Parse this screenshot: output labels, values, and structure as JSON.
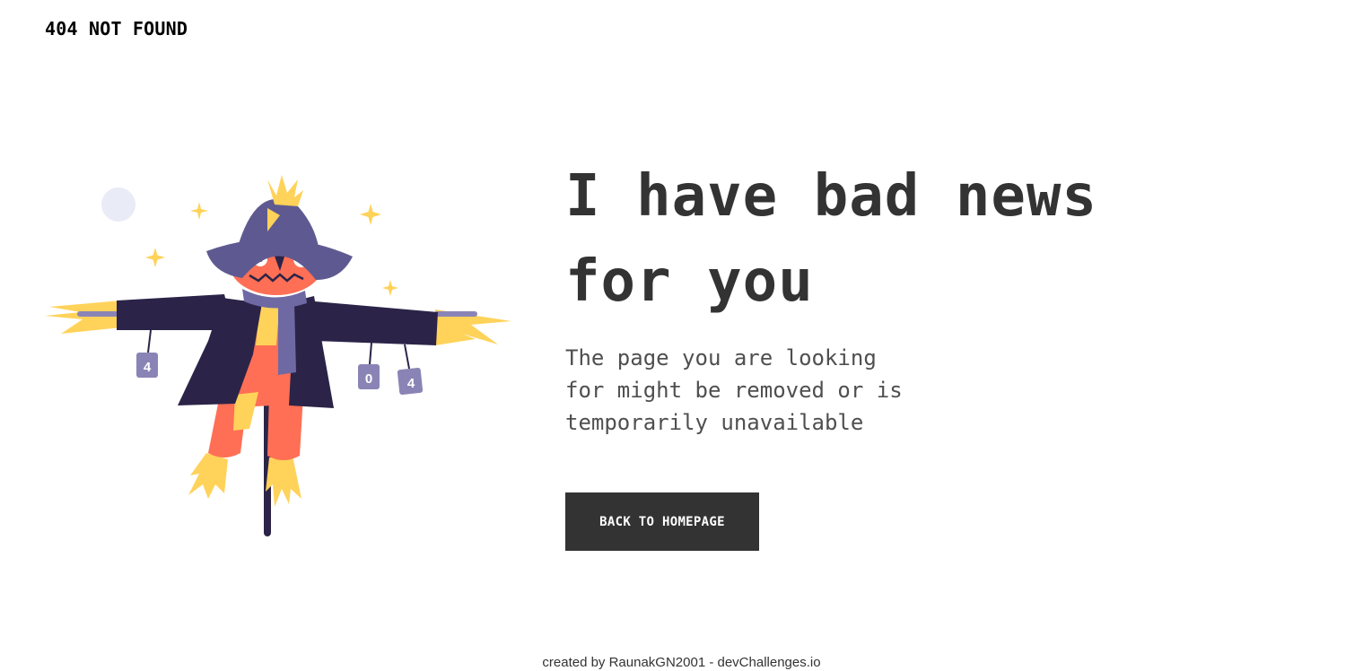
{
  "header": {
    "brand": "404 NOT FOUND"
  },
  "main": {
    "headline_line1": "I have bad news",
    "headline_line2": "for you",
    "subtext_line1": "The page you are looking",
    "subtext_line2": "for might be removed or is",
    "subtext_line3": "temporarily unavailable",
    "button_label": "BACK TO HOMEPAGE"
  },
  "illustration": {
    "icon": "scarecrow-illustration",
    "can_labels": [
      "4",
      "0",
      "4"
    ]
  },
  "footer": {
    "text": "created by RaunakGN2001 - devChallenges.io"
  },
  "colors": {
    "text_dark": "#333333",
    "text_muted": "#4f4f4f",
    "button_bg": "#333333",
    "button_text": "#ffffff",
    "hat": "#5e5a91",
    "coat": "#2b2448",
    "face": "#ff6f55",
    "straw": "#ffd25a",
    "cans": "#8a84b6"
  }
}
